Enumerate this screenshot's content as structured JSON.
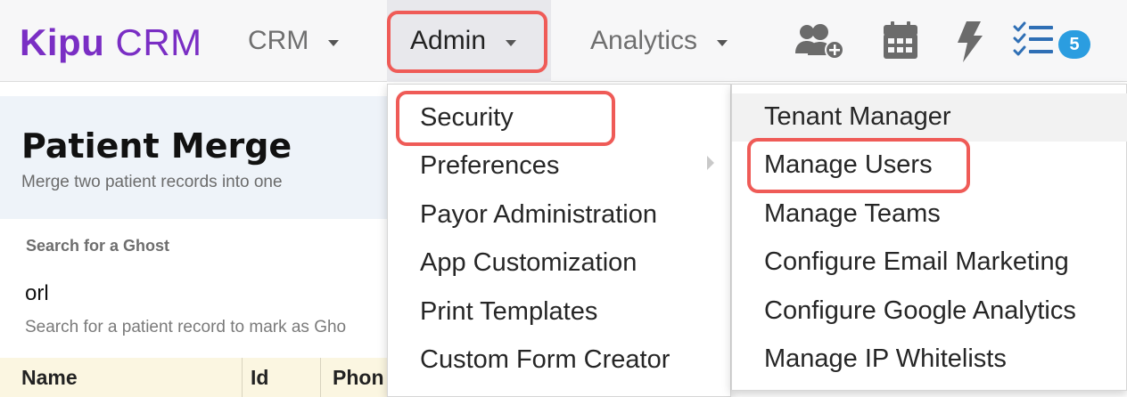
{
  "brand": {
    "part1": "Kipu",
    "part2": "CRM"
  },
  "nav": {
    "crm_label": "CRM",
    "admin_label": "Admin",
    "analytics_label": "Analytics"
  },
  "toolbar": {
    "icons": [
      "add-user-icon",
      "calendar-icon",
      "lightning-icon",
      "task-list-icon"
    ],
    "task_count": "5"
  },
  "page": {
    "title": "Patient Merge",
    "subtitle": "Merge two patient records into one",
    "search_label": "Search for a Ghost",
    "search_value": "orl",
    "search_help": "Search for a patient record to mark as Gho"
  },
  "table": {
    "columns": [
      "Name",
      "Id",
      "Phon"
    ]
  },
  "admin_menu": {
    "items": [
      "Security",
      "Preferences",
      "Payor Administration",
      "App Customization",
      "Print Templates",
      "Custom Form Creator"
    ]
  },
  "preferences_menu": {
    "items": [
      "Tenant Manager",
      "Manage Users",
      "Manage Teams",
      "Configure Email Marketing",
      "Configure Google Analytics",
      "Manage IP Whitelists"
    ]
  },
  "colors": {
    "brand": "#7a2ec4",
    "highlight": "#ef5b57",
    "badge": "#2b9de0",
    "icon": "#6b6b6b",
    "checklist": "#2f6fb5"
  }
}
